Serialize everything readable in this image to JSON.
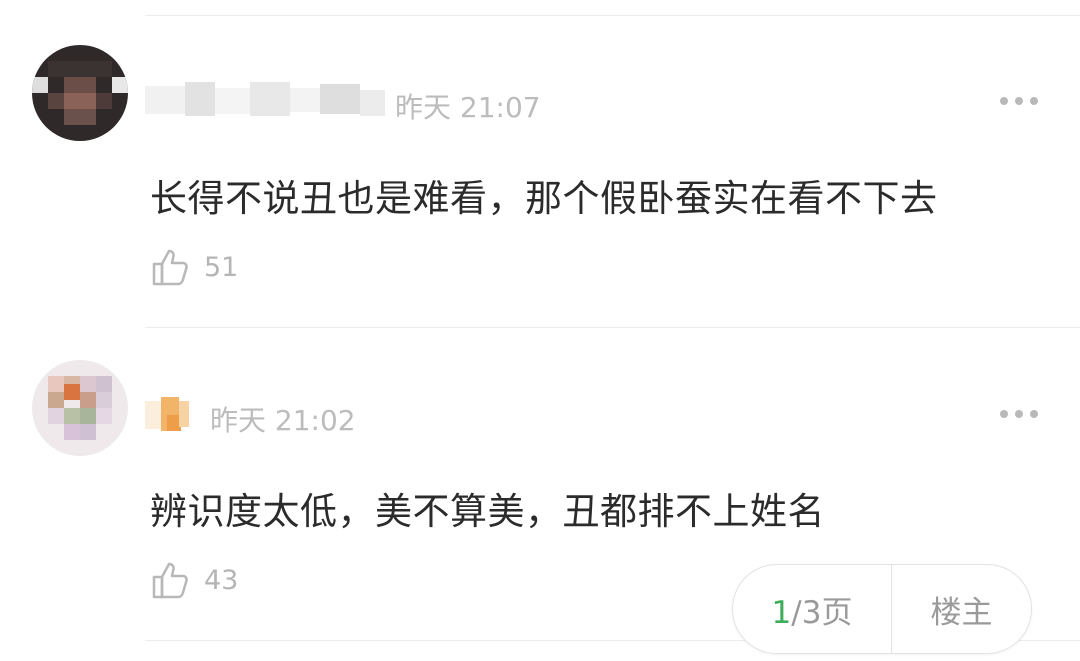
{
  "comments": [
    {
      "timestamp": "昨天 21:07",
      "content": "长得不说丑也是难看，那个假卧蚕实在看不下去",
      "likes": "51"
    },
    {
      "timestamp": "昨天 21:02",
      "content": "辨识度太低，美不算美，丑都排不上姓名",
      "likes": "43"
    }
  ],
  "pager": {
    "current": "1",
    "rest": "/3页",
    "owner_label": "楼主"
  },
  "icons": {
    "like": "thumbs-up-icon",
    "more": "more-dots-icon"
  }
}
